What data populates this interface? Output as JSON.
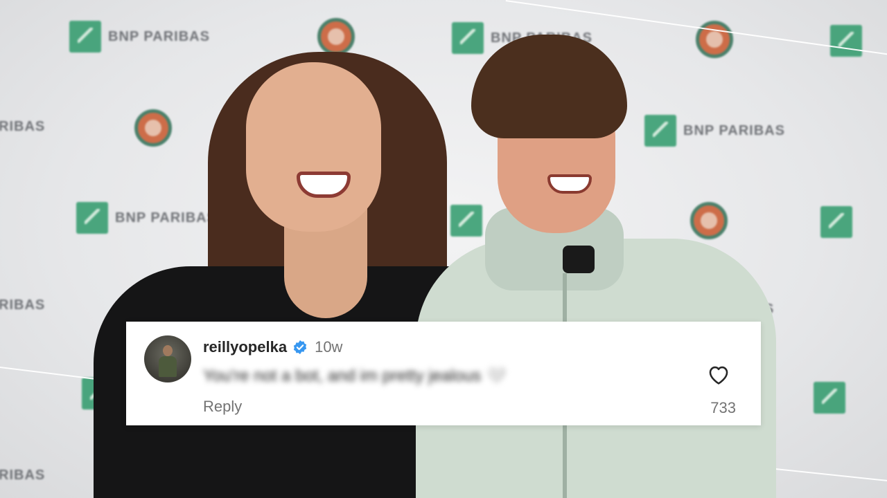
{
  "background": {
    "sponsor_brand": "BNP PARIBAS",
    "sponsor_partial": "RIBAS",
    "logo_icon": "roland-garros-icon",
    "sponsor_icon": "bnp-paribas-logo-icon"
  },
  "comment": {
    "avatar_icon": "avatar",
    "username": "reillyopelka",
    "verified_icon": "verified-badge-icon",
    "timestamp": "10w",
    "text": "You're not a bot, and im pretty jealous 🤍",
    "reply_label": "Reply",
    "like_icon": "heart-icon",
    "like_count": "733"
  },
  "colors": {
    "verified_blue": "#3797f0",
    "sponsor_green": "#2f9a6b",
    "text_primary": "#262626",
    "text_secondary": "#737373"
  }
}
